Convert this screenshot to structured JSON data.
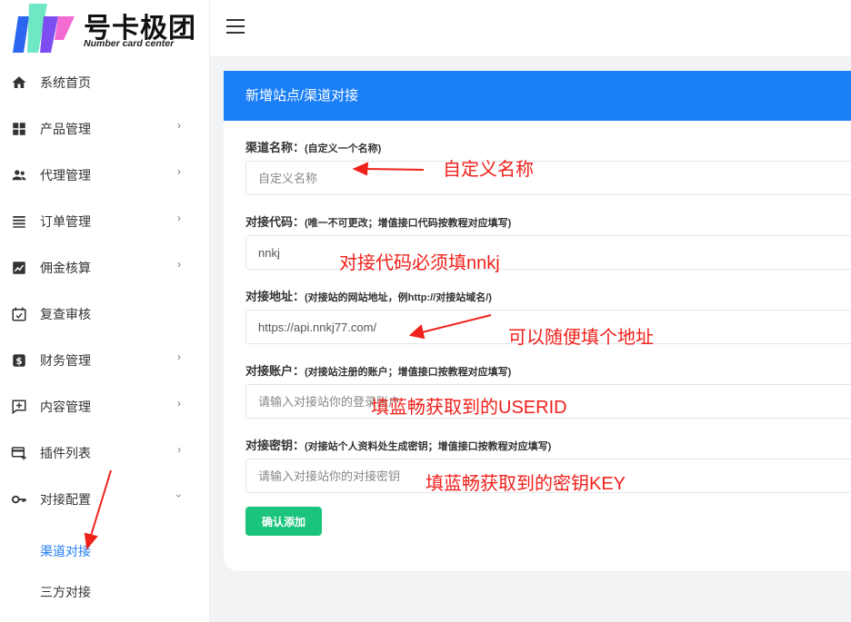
{
  "brand": {
    "title": "号卡极团",
    "subtitle": "Number card center"
  },
  "sidebar": {
    "items": [
      {
        "label": "系统首页",
        "icon": "home-icon",
        "has_chevron": false
      },
      {
        "label": "产品管理",
        "icon": "grid-icon",
        "has_chevron": true
      },
      {
        "label": "代理管理",
        "icon": "people-icon",
        "has_chevron": true
      },
      {
        "label": "订单管理",
        "icon": "list-icon",
        "has_chevron": true
      },
      {
        "label": "佣金核算",
        "icon": "chart-box-icon",
        "has_chevron": true
      },
      {
        "label": "复查审核",
        "icon": "calendar-check-icon",
        "has_chevron": false
      },
      {
        "label": "财务管理",
        "icon": "dollar-icon",
        "has_chevron": true
      },
      {
        "label": "内容管理",
        "icon": "comment-plus-icon",
        "has_chevron": true
      },
      {
        "label": "插件列表",
        "icon": "card-plus-icon",
        "has_chevron": true
      },
      {
        "label": "对接配置",
        "icon": "key-icon",
        "has_chevron": true,
        "expanded": true
      }
    ],
    "subitems": [
      {
        "label": "渠道对接",
        "active": true
      },
      {
        "label": "三方对接",
        "active": false
      }
    ]
  },
  "form": {
    "title": "新增站点/渠道对接",
    "fields": [
      {
        "label": "渠道名称：",
        "hint": "(自定义一个名称)",
        "value": "",
        "placeholder": "自定义名称"
      },
      {
        "label": "对接代码：",
        "hint": "(唯一不可更改；增值接口代码按教程对应填写)",
        "value": "nnkj",
        "placeholder": ""
      },
      {
        "label": "对接地址：",
        "hint": "(对接站的网站地址，例http://对接站域名/)",
        "value": "https://api.nnkj77.com/",
        "placeholder": ""
      },
      {
        "label": "对接账户：",
        "hint": "(对接站注册的账户；增值接口按教程对应填写)",
        "value": "",
        "placeholder": "请输入对接站你的登录账户"
      },
      {
        "label": "对接密钥：",
        "hint": "(对接站个人资料处生成密钥；增值接口按教程对应填写)",
        "value": "",
        "placeholder": "请输入对接站你的对接密钥"
      }
    ],
    "submit_label": "确认添加"
  },
  "annotations": [
    "自定义名称",
    "对接代码必须填nnkj",
    "可以随便填个地址",
    "填蓝畅获取到的USERID",
    "填蓝畅获取到的密钥KEY"
  ],
  "colors": {
    "accent": "#1b7ff7",
    "submit": "#1bc47d",
    "annotation": "#f0201a",
    "active_nav": "#1f7cf2"
  }
}
